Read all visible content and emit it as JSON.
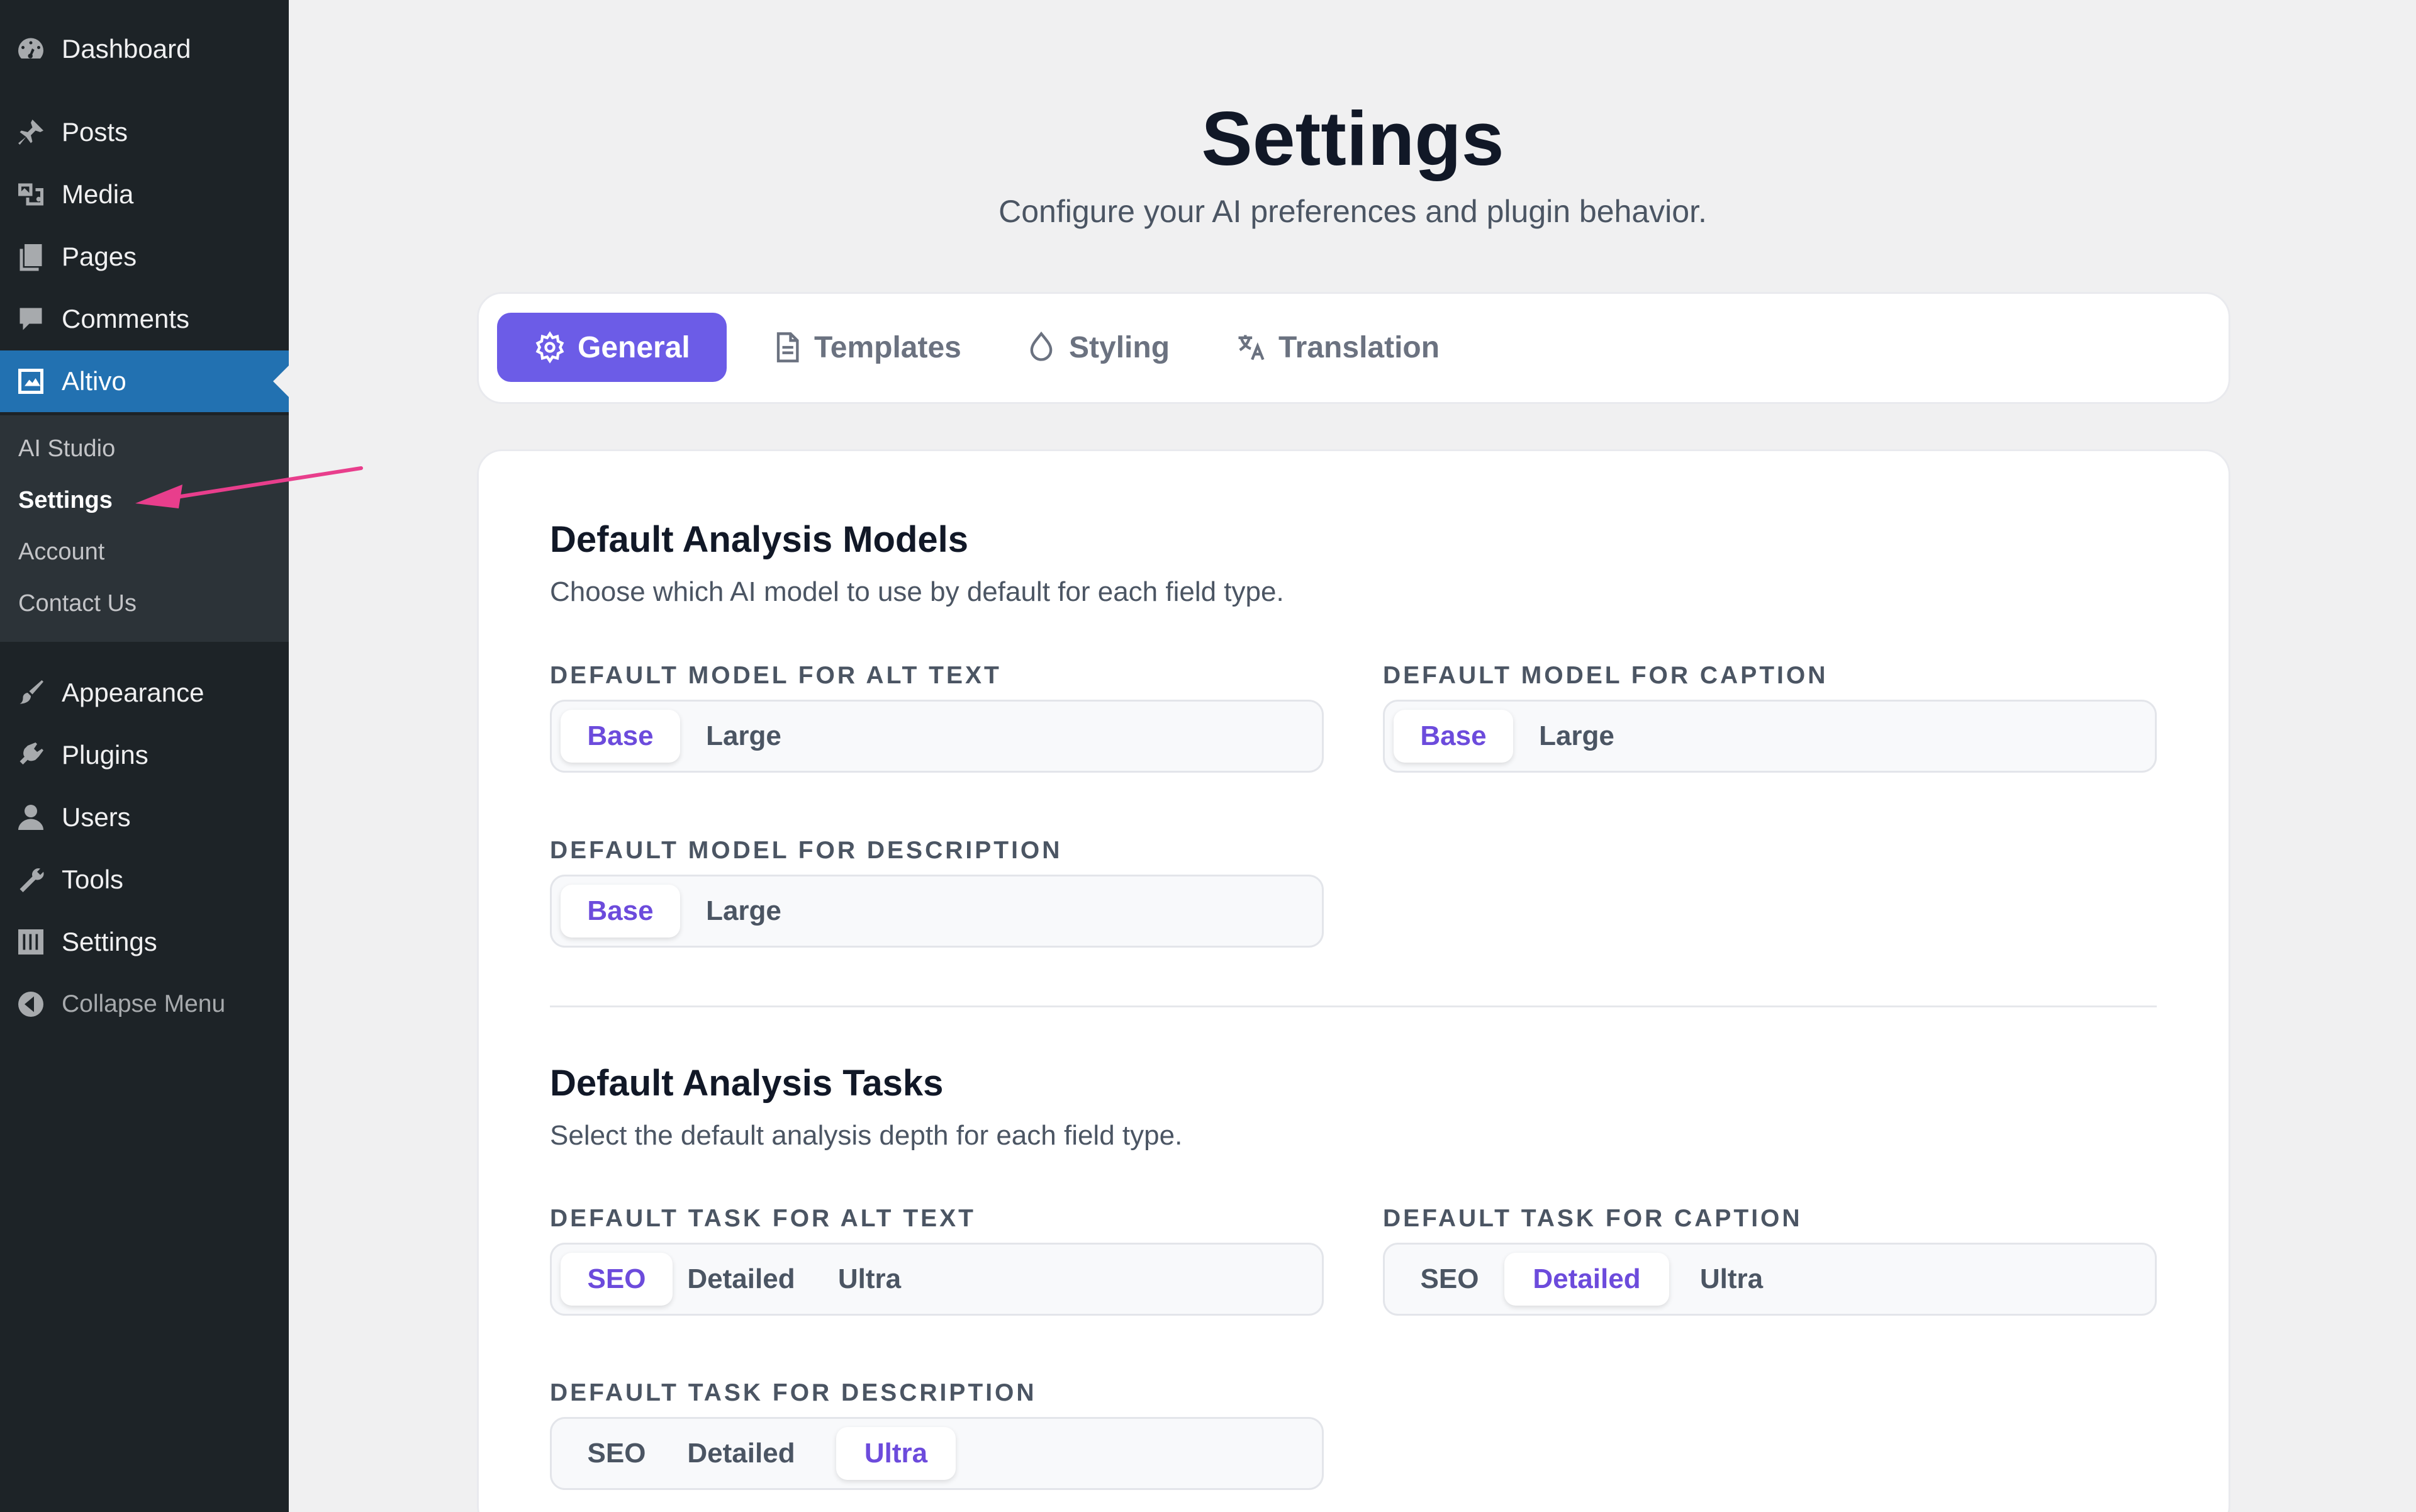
{
  "sidebar": {
    "items": [
      {
        "label": "Dashboard",
        "icon": "dashboard-icon"
      },
      {
        "label": "Posts",
        "icon": "pushpin-icon"
      },
      {
        "label": "Media",
        "icon": "media-icon"
      },
      {
        "label": "Pages",
        "icon": "pages-icon"
      },
      {
        "label": "Comments",
        "icon": "comment-icon"
      },
      {
        "label": "Altivo",
        "icon": "altivo-image-icon"
      },
      {
        "label": "Appearance",
        "icon": "paintbrush-icon"
      },
      {
        "label": "Plugins",
        "icon": "plugin-icon"
      },
      {
        "label": "Users",
        "icon": "user-icon"
      },
      {
        "label": "Tools",
        "icon": "wrench-icon"
      },
      {
        "label": "Settings",
        "icon": "settings-sliders-icon"
      },
      {
        "label": "Collapse Menu",
        "icon": "collapse-arrow-icon"
      }
    ],
    "submenu": [
      "AI Studio",
      "Settings",
      "Account",
      "Contact Us"
    ],
    "colors": {
      "background": "#1d2327",
      "active": "#2271b1",
      "submenu": "#2c3338"
    }
  },
  "header": {
    "title": "Settings",
    "subtitle": "Configure your AI preferences and plugin behavior."
  },
  "tabs": [
    {
      "label": "General",
      "icon": "gear-icon",
      "active": true
    },
    {
      "label": "Templates",
      "icon": "document-icon",
      "active": false
    },
    {
      "label": "Styling",
      "icon": "droplet-icon",
      "active": false
    },
    {
      "label": "Translation",
      "icon": "translate-icon",
      "active": false
    }
  ],
  "models": {
    "title": "Default Analysis Models",
    "description": "Choose which AI model to use by default for each field type.",
    "alt_text": {
      "label": "DEFAULT MODEL FOR ALT TEXT",
      "options": [
        "Base",
        "Large"
      ],
      "selected": "Base"
    },
    "caption": {
      "label": "DEFAULT MODEL FOR CAPTION",
      "options": [
        "Base",
        "Large"
      ],
      "selected": "Base"
    },
    "description_field": {
      "label": "DEFAULT MODEL FOR DESCRIPTION",
      "options": [
        "Base",
        "Large"
      ],
      "selected": "Base"
    }
  },
  "tasks": {
    "title": "Default Analysis Tasks",
    "description": "Select the default analysis depth for each field type.",
    "alt_text": {
      "label": "DEFAULT TASK FOR ALT TEXT",
      "options": [
        "SEO",
        "Detailed",
        "Ultra"
      ],
      "selected": "SEO"
    },
    "caption": {
      "label": "DEFAULT TASK FOR CAPTION",
      "options": [
        "SEO",
        "Detailed",
        "Ultra"
      ],
      "selected": "Detailed"
    },
    "description_field": {
      "label": "DEFAULT TASK FOR DESCRIPTION",
      "options": [
        "SEO",
        "Detailed",
        "Ultra"
      ],
      "selected": "Ultra"
    }
  },
  "accent_color": "#6c5ce7",
  "annotation_arrow_color": "#e83e8c"
}
